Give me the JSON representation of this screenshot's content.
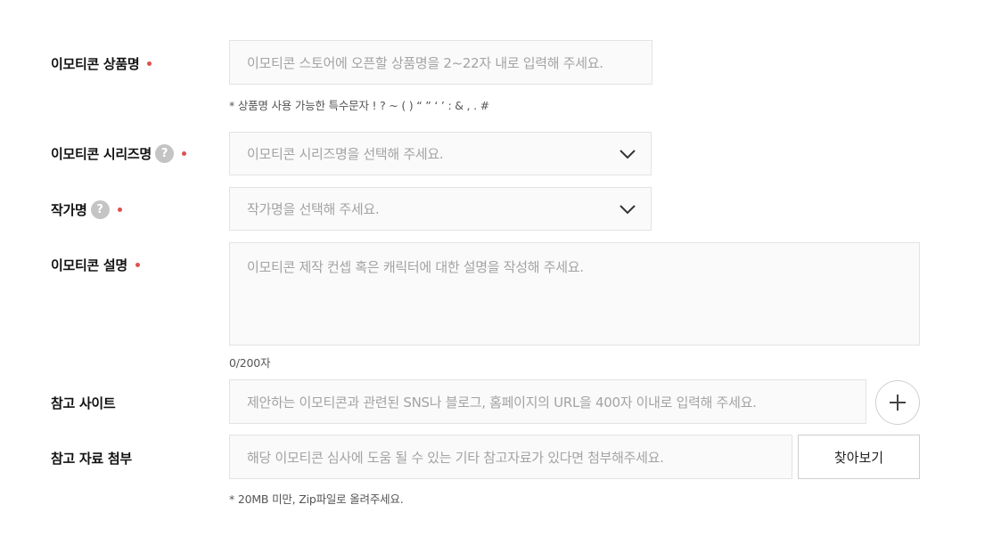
{
  "form": {
    "product_name": {
      "label": "이모티콘 상품명",
      "placeholder": "이모티콘 스토어에 오픈할 상품명을 2~22자 내로 입력해 주세요.",
      "hint": "* 상품명 사용 가능한 특수문자 ! ? ~ ( ) “ ” ‘ ’ : & , . #"
    },
    "series_name": {
      "label": "이모티콘 시리즈명",
      "help": "?",
      "placeholder": "이모티콘 시리즈명을 선택해 주세요."
    },
    "author_name": {
      "label": "작가명",
      "help": "?",
      "placeholder": "작가명을 선택해 주세요."
    },
    "description": {
      "label": "이모티콘 설명",
      "placeholder": "이모티콘 제작 컨셉 혹은 캐릭터에 대한 설명을 작성해 주세요.",
      "counter": "0/200자"
    },
    "reference_site": {
      "label": "참고 사이트",
      "placeholder": "제안하는 이모티콘과 관련된 SNS나 블로그, 홈페이지의 URL을 400자 이내로 입력해 주세요."
    },
    "attachment": {
      "label": "참고 자료 첨부",
      "placeholder": "해당 이모티콘 심사에 도움 될 수 있는 기타 참고자료가 있다면 첨부해주세요.",
      "browse_label": "찾아보기",
      "hint": "* 20MB 미만, Zip파일로 올려주세요."
    }
  },
  "colors": {
    "required_dot": "#e0504d",
    "help_icon_bg": "#c4c4c4",
    "field_border": "#e3e3e3",
    "field_bg": "#fafafa",
    "placeholder_text": "#a3a3a3"
  },
  "icons": {
    "required": "required-dot-icon",
    "help": "question-mark-icon",
    "dropdown": "chevron-down-icon",
    "add": "plus-icon"
  }
}
